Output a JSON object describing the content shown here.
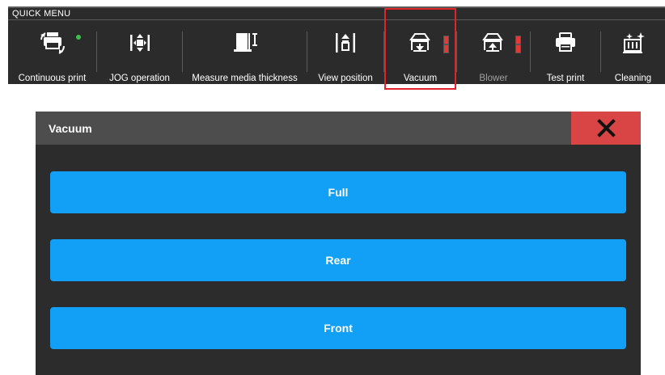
{
  "quick_menu": {
    "title": "QUICK MENU",
    "items": [
      {
        "label": "Continuous print",
        "icon": "continuous-print-icon",
        "status": "active"
      },
      {
        "label": "JOG operation",
        "icon": "jog-icon"
      },
      {
        "label": "Measure media thickness",
        "icon": "media-thickness-icon"
      },
      {
        "label": "View position",
        "icon": "view-position-icon"
      },
      {
        "label": "Vacuum",
        "icon": "vacuum-icon",
        "selected": true
      },
      {
        "label": "Blower",
        "icon": "blower-icon",
        "disabled": true
      },
      {
        "label": "Test print",
        "icon": "printer-icon"
      },
      {
        "label": "Cleaning",
        "icon": "cleaning-icon"
      }
    ]
  },
  "dialog": {
    "title": "Vacuum",
    "close_icon": "close-icon",
    "options": [
      "Full",
      "Rear",
      "Front"
    ]
  },
  "colors": {
    "accent": "#12A0F7",
    "close": "#D94545",
    "selection": "#E0242B",
    "status_dot": "#3CC24A",
    "indicator": "#E53935"
  }
}
